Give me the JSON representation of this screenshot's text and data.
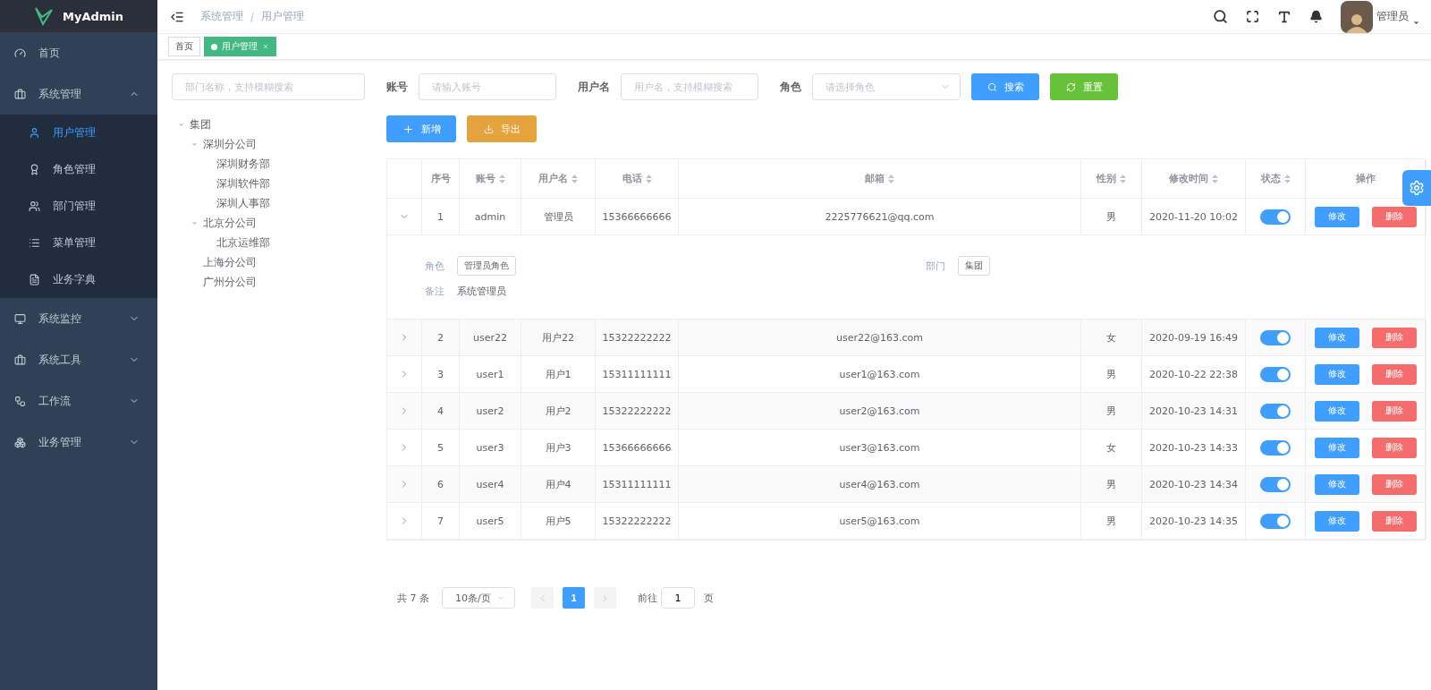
{
  "sidebar": {
    "logo": "MyAdmin",
    "items": [
      {
        "label": "首页",
        "selected": false
      },
      {
        "label": "系统管理",
        "expanded": true,
        "selected": false,
        "children": [
          {
            "label": "用户管理",
            "selected": true
          },
          {
            "label": "角色管理",
            "selected": false
          },
          {
            "label": "部门管理",
            "selected": false
          },
          {
            "label": "菜单管理",
            "selected": false
          },
          {
            "label": "业务字典",
            "selected": false
          }
        ]
      },
      {
        "label": "系统监控",
        "expanded": false,
        "selected": false
      },
      {
        "label": "系统工具",
        "expanded": false,
        "selected": false
      },
      {
        "label": "工作流",
        "expanded": false,
        "selected": false
      },
      {
        "label": "业务管理",
        "expanded": false,
        "selected": false
      }
    ]
  },
  "header": {
    "breadcrumbs": [
      "系统管理",
      "用户管理"
    ],
    "separator": "/",
    "user": "管理员"
  },
  "tags": [
    {
      "label": "首页",
      "selected": false
    },
    {
      "label": "用户管理",
      "selected": true
    }
  ],
  "tree": {
    "placeholder": "部门名称，支持模糊搜索",
    "nodes": [
      {
        "label": "集团",
        "expanded": true,
        "children": [
          {
            "label": "深圳分公司",
            "expanded": true,
            "children": [
              {
                "label": "深圳财务部"
              },
              {
                "label": "深圳软件部"
              },
              {
                "label": "深圳人事部"
              }
            ]
          },
          {
            "label": "北京分公司",
            "expanded": true,
            "children": [
              {
                "label": "北京运维部"
              }
            ]
          },
          {
            "label": "上海分公司"
          },
          {
            "label": "广州分公司"
          }
        ]
      }
    ]
  },
  "filters": [
    {
      "label": "账号",
      "placeholder": "请输入账号",
      "kind": "input"
    },
    {
      "label": "用户名",
      "placeholder": "用户名，支持模糊搜索",
      "kind": "input"
    },
    {
      "label": "角色",
      "placeholder": "请选择角色",
      "kind": "select"
    }
  ],
  "filter_buttons": [
    {
      "label": "搜索",
      "kind": "search"
    },
    {
      "label": "重置",
      "kind": "reset"
    }
  ],
  "actions": [
    {
      "label": "新增",
      "kind": "add"
    },
    {
      "label": "导出",
      "kind": "export"
    }
  ],
  "table": {
    "columns": [
      {
        "label": "序号",
        "sortable": false
      },
      {
        "label": "账号",
        "sortable": true
      },
      {
        "label": "用户名",
        "sortable": true
      },
      {
        "label": "电话",
        "sortable": true
      },
      {
        "label": "邮箱",
        "sortable": true
      },
      {
        "label": "性别",
        "sortable": true
      },
      {
        "label": "修改时间",
        "sortable": true
      },
      {
        "label": "状态",
        "sortable": true
      },
      {
        "label": "操作",
        "sortable": false
      }
    ],
    "rows": [
      {
        "index": "1",
        "account": "admin",
        "username": "管理员",
        "phone": "15366666666",
        "email": "2225776621@qq.com",
        "gender": "男",
        "modified": "2020-11-20 10:02",
        "enabled": true,
        "edit": "修改",
        "delete": "删除",
        "expanded": true,
        "details": {
          "role_label": "角色",
          "role": "管理员角色",
          "dept_label": "部门",
          "dept": "集团",
          "note_label": "备注",
          "note": "系统管理员"
        }
      },
      {
        "index": "2",
        "account": "user22",
        "username": "用户22",
        "phone": "15322222222",
        "email": "user22@163.com",
        "gender": "女",
        "modified": "2020-09-19 16:49",
        "enabled": true,
        "edit": "修改",
        "delete": "删除",
        "expanded": false
      },
      {
        "index": "3",
        "account": "user1",
        "username": "用户1",
        "phone": "15311111111",
        "email": "user1@163.com",
        "gender": "男",
        "modified": "2020-10-22 22:38",
        "enabled": true,
        "edit": "修改",
        "delete": "删除",
        "expanded": false
      },
      {
        "index": "4",
        "account": "user2",
        "username": "用户2",
        "phone": "15322222222",
        "email": "user2@163.com",
        "gender": "男",
        "modified": "2020-10-23 14:31",
        "enabled": true,
        "edit": "修改",
        "delete": "删除",
        "expanded": false
      },
      {
        "index": "5",
        "account": "user3",
        "username": "用户3",
        "phone": "15366666666",
        "email": "user3@163.com",
        "gender": "女",
        "modified": "2020-10-23 14:33",
        "enabled": true,
        "edit": "修改",
        "delete": "删除",
        "expanded": false
      },
      {
        "index": "6",
        "account": "user4",
        "username": "用户4",
        "phone": "15311111111",
        "email": "user4@163.com",
        "gender": "男",
        "modified": "2020-10-23 14:34",
        "enabled": true,
        "edit": "修改",
        "delete": "删除",
        "expanded": false
      },
      {
        "index": "7",
        "account": "user5",
        "username": "用户5",
        "phone": "15322222222",
        "email": "user5@163.com",
        "gender": "男",
        "modified": "2020-10-23 14:35",
        "enabled": true,
        "edit": "修改",
        "delete": "删除",
        "expanded": false
      }
    ]
  },
  "pagination": {
    "total": "共 7 条",
    "page_size": "10条/页",
    "pages": [
      {
        "label": "1",
        "selected": true
      }
    ],
    "goto_label": "前往",
    "goto_value": "1",
    "goto_suffix": "页"
  }
}
